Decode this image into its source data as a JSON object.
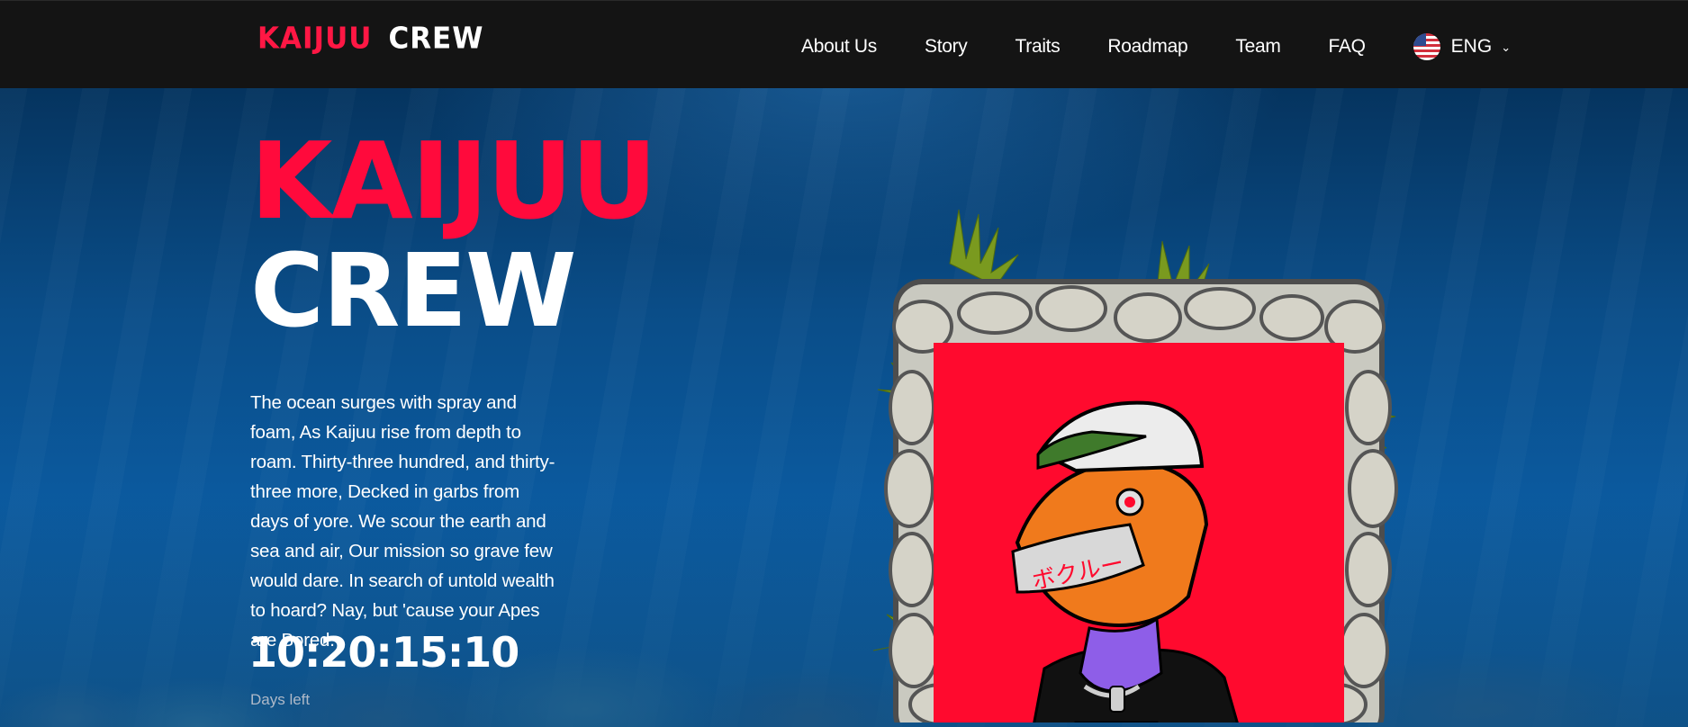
{
  "header": {
    "logo": {
      "part1": "KAIJUU",
      "part2": "CREW"
    },
    "nav": [
      "About Us",
      "Story",
      "Traits",
      "Roadmap",
      "Team",
      "FAQ"
    ],
    "language": "ENG"
  },
  "hero": {
    "title_line1": "KAIJUU",
    "title_line2": "CREW",
    "poem": "The ocean surges with spray and foam, As Kaijuu rise from depth to roam. Thirty-three hundred, and thirty-three more, Decked in garbs from days of yore. We scour the earth and sea and air, Our mission so grave few would dare. In search of untold wealth to hoard? Nay, but 'cause your Apes are Bored.",
    "countdown": "10:20:15:10",
    "countdown_label": "Days left",
    "art_mask_text": "ボクルー"
  },
  "colors": {
    "accent": "#ff0a3c",
    "navbar": "#141414",
    "ocean": "#0b4f8f"
  }
}
